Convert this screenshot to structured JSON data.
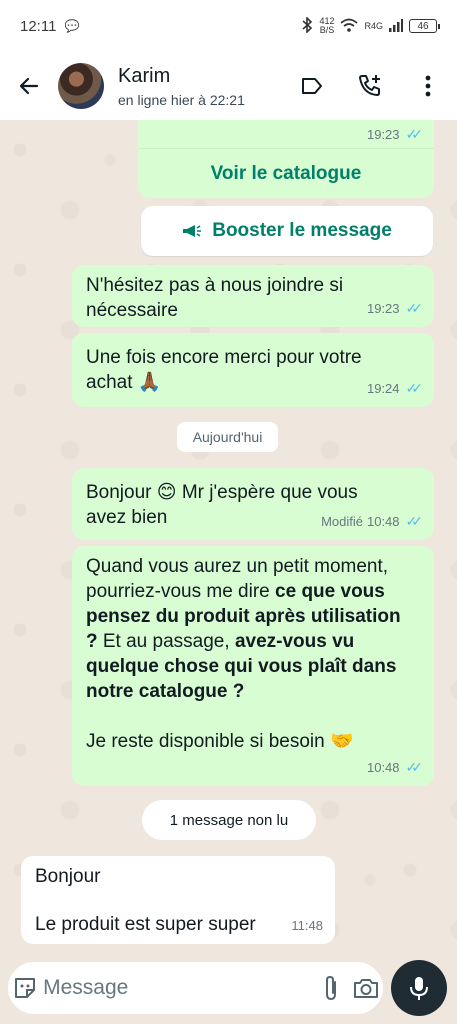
{
  "status_bar": {
    "time": "12:11",
    "net_speed_value": "412",
    "net_speed_unit": "B/S",
    "carrier": "R4G",
    "battery": "46"
  },
  "header": {
    "contact_name": "Karim",
    "contact_status": "en ligne hier à 22:21",
    "icons": [
      "back-arrow-icon",
      "label-icon",
      "add-call-icon",
      "more-vert-icon"
    ]
  },
  "messages": {
    "catalog": {
      "time": "19:23",
      "button_label": "Voir le catalogue"
    },
    "boost_label": "Booster le message",
    "msg1": {
      "text": "N'hésitez pas à nous joindre si nécessaire",
      "time": "19:23"
    },
    "msg2": {
      "text": "Une fois encore merci pour votre achat 🙏🏾",
      "time": "19:24"
    },
    "date_divider": "Aujourd'hui",
    "msg3": {
      "text": "Bonjour 😊 Mr j'espère que vous avez bien",
      "edited": "Modifié",
      "time": "10:48"
    },
    "msg4": {
      "p1": "Quand vous aurez un petit moment, pourriez-vous me dire ",
      "p1_bold": "ce que vous pensez du produit après utilisation ?",
      "p2": " Et au passage, ",
      "p2_bold": "avez-vous vu quelque chose qui vous plaît dans notre catalogue ?",
      "p3": "Je reste disponible si besoin 🤝",
      "time": "10:48"
    },
    "unread_divider": "1 message non lu",
    "msg5": {
      "line1": "Bonjour",
      "line2": "Le produit est super super",
      "time": "11:48"
    }
  },
  "input": {
    "placeholder": "Message",
    "value": ""
  },
  "colors": {
    "outgoing_bubble": "#d9fdd3",
    "incoming_bubble": "#ffffff",
    "accent_green": "#008069",
    "read_ticks": "#53bdeb",
    "chat_background": "#efe7de"
  }
}
